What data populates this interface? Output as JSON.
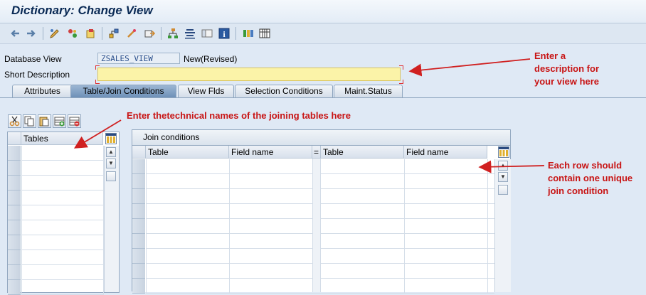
{
  "window": {
    "title": "Dictionary: Change View"
  },
  "toolbar": {
    "icons": [
      "back-arrow-icon",
      "forward-arrow-icon",
      "display-change-icon",
      "other-object-icon",
      "activate-icon",
      "where-used-icon",
      "object-list-icon",
      "display-object-list-icon",
      "hierarchy-icon",
      "transport-icon",
      "information-icon",
      "help-icon",
      "table-structure-icon",
      "settings-icon"
    ]
  },
  "header": {
    "database_view_label": "Database View",
    "database_view_value": "ZSALES_VIEW",
    "status": "New(Revised)",
    "short_description_label": "Short Description",
    "short_description_value": ""
  },
  "tabs": [
    {
      "label": "Attributes",
      "active": false
    },
    {
      "label": "Table/Join Conditions",
      "active": true
    },
    {
      "label": "View Flds",
      "active": false
    },
    {
      "label": "Selection Conditions",
      "active": false
    },
    {
      "label": "Maint.Status",
      "active": false
    }
  ],
  "tables_grid": {
    "header": "Tables",
    "rows": 10
  },
  "join_grid": {
    "title": "Join conditions",
    "columns": [
      "Table",
      "Field name",
      "=",
      "Table",
      "Field name"
    ],
    "rows": 9
  },
  "annotations": {
    "description_note": "Enter a description for your view here",
    "description_note_lines": [
      "Enter a",
      "description for",
      "your view here"
    ],
    "tables_note": "Enter thetechnical names of the joining tables here",
    "join_note_lines": [
      "Each row should",
      "contain one unique",
      "join condition"
    ]
  },
  "colors": {
    "annotation": "#c81414",
    "active_tab": "#7e9dc2",
    "required_field": "#fbf3a8"
  }
}
